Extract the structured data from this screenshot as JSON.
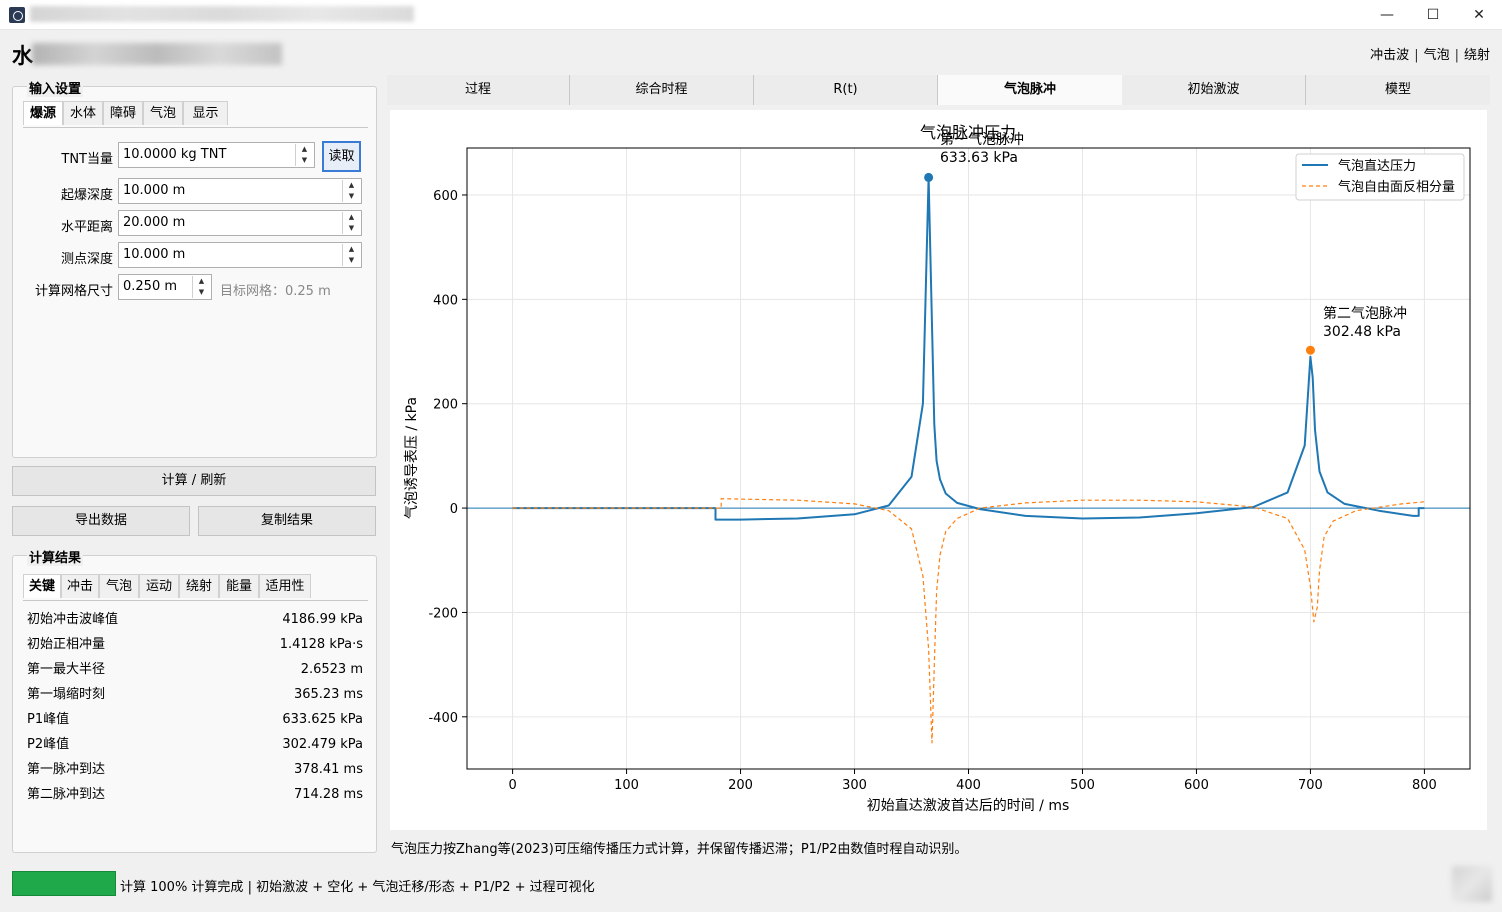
{
  "window": {
    "header_title_char": "水",
    "quick_nav": [
      "冲击波",
      "气泡",
      "绕射"
    ]
  },
  "input_settings": {
    "title": "输入设置",
    "tabs": [
      "爆源",
      "水体",
      "障碍",
      "气泡",
      "显示"
    ],
    "active_tab": "爆源",
    "fields": {
      "tnt": {
        "label": "TNT当量",
        "value": "10.0000 kg TNT",
        "button": "读取"
      },
      "burst_depth": {
        "label": "起爆深度",
        "value": "10.000 m"
      },
      "horizontal_distance": {
        "label": "水平距离",
        "value": "20.000 m"
      },
      "gauge_depth": {
        "label": "测点深度",
        "value": "10.000 m"
      },
      "grid_size": {
        "label": "计算网格尺寸",
        "value": "0.250 m",
        "hint": "目标网格：0.25 m"
      }
    }
  },
  "actions": {
    "compute": "计算 / 刷新",
    "export": "导出数据",
    "copy": "复制结果"
  },
  "results": {
    "title": "计算结果",
    "tabs": [
      "关键",
      "冲击",
      "气泡",
      "运动",
      "绕射",
      "能量",
      "适用性"
    ],
    "active_tab": "关键",
    "rows": [
      {
        "label": "初始冲击波峰值",
        "value": "4186.99 kPa"
      },
      {
        "label": "初始正相冲量",
        "value": "1.4128 kPa·s"
      },
      {
        "label": "第一最大半径",
        "value": "2.6523 m"
      },
      {
        "label": "第一塌缩时刻",
        "value": "365.23 ms"
      },
      {
        "label": "P1峰值",
        "value": "633.625 kPa"
      },
      {
        "label": "P2峰值",
        "value": "302.479 kPa"
      },
      {
        "label": "第一脉冲到达",
        "value": "378.41 ms"
      },
      {
        "label": "第二脉冲到达",
        "value": "714.28 ms"
      }
    ]
  },
  "main_tabs": [
    "过程",
    "综合时程",
    "R(t)",
    "气泡脉冲",
    "初始激波",
    "模型"
  ],
  "active_main_tab": "气泡脉冲",
  "chart_data": {
    "type": "line",
    "title": "气泡脉冲压力",
    "xlabel": "初始直达激波首达后的时间 / ms",
    "ylabel": "气泡诱导表压 / kPa",
    "xlim": [
      -40,
      840
    ],
    "ylim": [
      -500,
      690
    ],
    "xticks": [
      0,
      100,
      200,
      300,
      400,
      500,
      600,
      700,
      800
    ],
    "yticks": [
      600,
      400,
      200,
      0,
      -200,
      -400
    ],
    "xtick_labels": [
      "0",
      "100",
      "200",
      "300",
      "400",
      "500",
      "600",
      "700",
      "800"
    ],
    "ytick_labels": [
      "600",
      "400",
      "200",
      "0",
      "-200",
      "-400"
    ],
    "grid": true,
    "legend_position": "top-right",
    "series": [
      {
        "name": "气泡直达压力",
        "color": "#1f77b4",
        "style": "solid",
        "x": [
          0,
          178,
          178,
          200,
          250,
          300,
          330,
          350,
          360,
          365,
          368,
          370,
          372,
          375,
          380,
          390,
          410,
          450,
          500,
          550,
          600,
          650,
          680,
          695,
          700,
          702,
          704,
          708,
          715,
          730,
          760,
          790,
          795,
          795,
          800
        ],
        "y": [
          0,
          0,
          -22,
          -22,
          -20,
          -12,
          5,
          60,
          200,
          633.63,
          350,
          160,
          90,
          55,
          28,
          10,
          -2,
          -15,
          -20,
          -18,
          -10,
          2,
          30,
          120,
          290,
          250,
          150,
          70,
          30,
          8,
          -5,
          -15,
          -15,
          0,
          0
        ]
      },
      {
        "name": "气泡自由面反相分量",
        "color": "#ff7f0e",
        "style": "dashed",
        "x": [
          0,
          183,
          183,
          250,
          300,
          330,
          350,
          360,
          365,
          368,
          370,
          372,
          375,
          380,
          390,
          410,
          450,
          500,
          550,
          600,
          650,
          680,
          695,
          700,
          703,
          706,
          708,
          712,
          720,
          740,
          780,
          800
        ],
        "y": [
          0,
          0,
          18,
          15,
          8,
          -5,
          -40,
          -130,
          -270,
          -450,
          -300,
          -160,
          -90,
          -45,
          -20,
          0,
          10,
          15,
          15,
          12,
          2,
          -20,
          -80,
          -150,
          -218,
          -190,
          -120,
          -55,
          -25,
          -5,
          8,
          12
        ]
      }
    ],
    "annotations": [
      {
        "label": "第一气泡脉冲",
        "value": "633.63 kPa",
        "x": 365,
        "y": 633.63,
        "color": "#1f77b4"
      },
      {
        "label": "第二气泡脉冲",
        "value": "302.48 kPa",
        "x": 700,
        "y": 302.48,
        "color": "#ff7f0e"
      }
    ]
  },
  "footnote": "气泡压力按Zhang等(2023)可压缩传播压力式计算，并保留传播迟滞；P1/P2由数值时程自动识别。",
  "status": {
    "progress_percent": 100,
    "progress_color": "#1fa94a",
    "text": "计算 100%  计算完成 | 初始激波 + 空化 + 气泡迁移/形态 + P1/P2 + 过程可视化"
  }
}
